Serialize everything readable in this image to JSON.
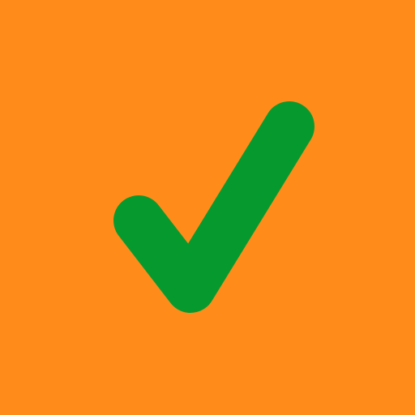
{
  "icon": {
    "name": "checkmark-icon",
    "background_color": "#FF8C1A",
    "stroke_color": "#069A2E"
  }
}
